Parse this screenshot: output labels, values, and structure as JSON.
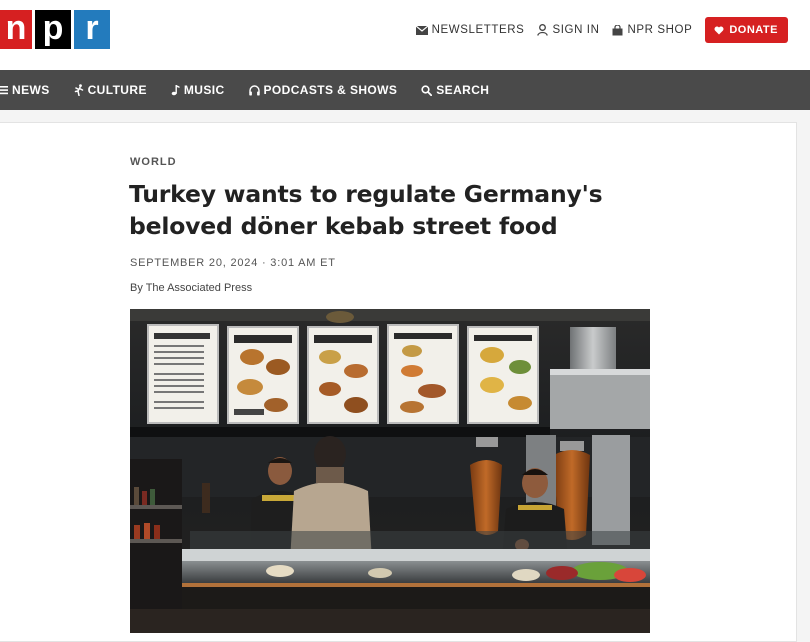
{
  "brand": {
    "letters": [
      "n",
      "p",
      "r"
    ]
  },
  "utility": {
    "newsletters": "NEWSLETTERS",
    "sign_in": "SIGN IN",
    "shop": "NPR SHOP",
    "donate": "DONATE"
  },
  "nav": {
    "items": [
      {
        "label": "NEWS",
        "icon": "menu-icon"
      },
      {
        "label": "CULTURE",
        "icon": "figure-icon"
      },
      {
        "label": "MUSIC",
        "icon": "music-note-icon"
      },
      {
        "label": "PODCASTS & SHOWS",
        "icon": "headphones-icon"
      },
      {
        "label": "SEARCH",
        "icon": "search-icon"
      }
    ]
  },
  "article": {
    "slug": "WORLD",
    "headline": "Turkey wants to regulate Germany's beloved döner kebab street food",
    "date": "SEPTEMBER 20, 2024 · 3:01 AM ET",
    "byline": "By The Associated Press"
  },
  "colors": {
    "brand_red": "#d62021",
    "brand_blue": "#237bbd",
    "nav_bg": "#4a4a4a"
  }
}
